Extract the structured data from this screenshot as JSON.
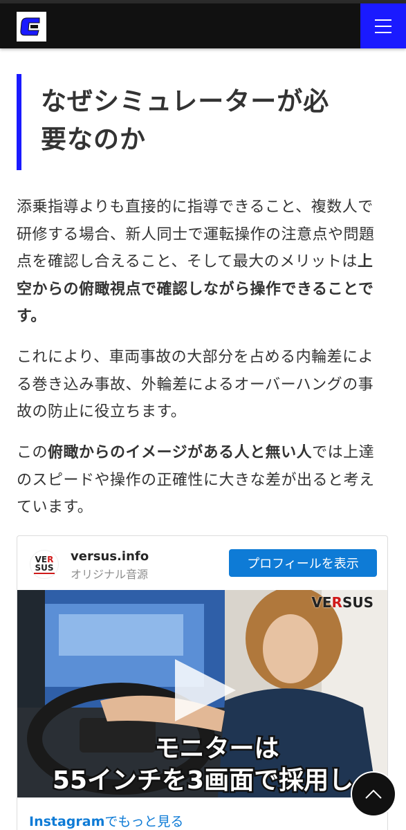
{
  "header": {
    "logo_icon": "site-logo-c",
    "menu_icon": "hamburger-icon",
    "brand_color": "#1a1aff"
  },
  "article": {
    "heading_line1": "なぜシミュレーターが必",
    "heading_line2": "要なのか",
    "p1_text": "添乗指導よりも直接的に指導できること、複数人で研修する場合、新人同士で運転操作の注意点や問題点を確認し合えること、そして最大のメリットは",
    "p1_bold": "上空からの俯瞰視点で確認しながら操作できることです。",
    "p2_text": "これにより、車両事故の大部分を占める内輪差による巻き込み事故、外輪差によるオーバーハングの事故の防止に役立ちます。",
    "p3_pre": "この",
    "p3_bold1": "俯瞰からのイメージがある人と無い人",
    "p3_post": "では上達のスピードや操作の正確性に大きな差が出ると考えています。"
  },
  "embed": {
    "avatar_line1_a": "VE",
    "avatar_line1_r": "R",
    "avatar_line2": "SUS",
    "account_name": "versus.info",
    "audio_label": "オリジナル音源",
    "profile_button": "プロフィールを表示",
    "video_caption_line1": "モニターは",
    "video_caption_line2": "55インチを3画面で採用し",
    "video_logo_a": "VE",
    "video_logo_r": "R",
    "video_logo_b": "SUS",
    "more_link_bold": "Instagram",
    "more_link_rest": "でもっと見る",
    "link_color": "#0e7bd6"
  },
  "scroll_top": {
    "icon": "chevron-up-icon"
  }
}
